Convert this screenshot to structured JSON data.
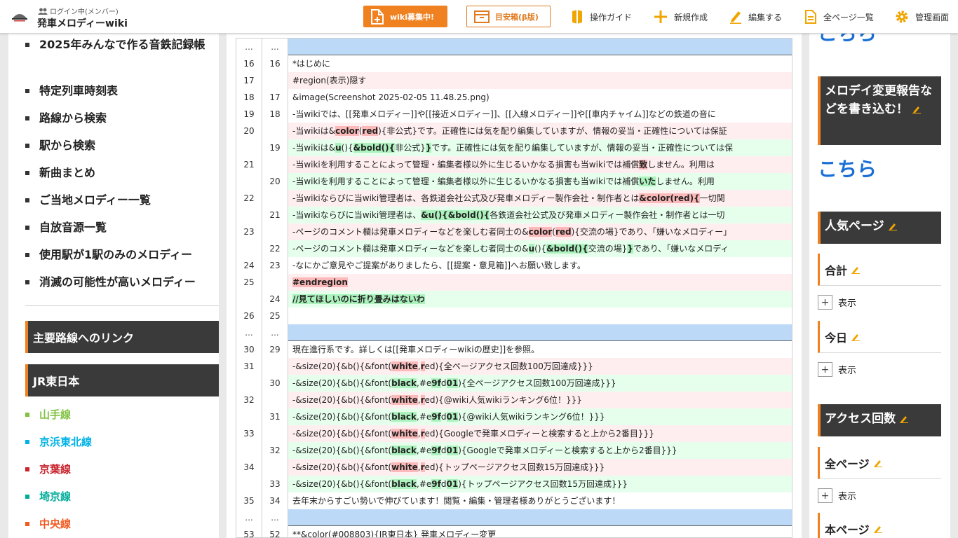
{
  "header": {
    "login_status": "ログイン中(メンバー)",
    "site_title": "発車メロディーwiki",
    "recruit_button": "wiki募集中!",
    "box_button": "目安箱(β版)",
    "nav": [
      "操作ガイド",
      "新規作成",
      "編集する",
      "全ページ一覧",
      "管理画面"
    ]
  },
  "left_menu": {
    "items": [
      "2025年みんなで作る音鉄記録帳",
      "特定列車時刻表",
      "路線から検索",
      "駅から検索",
      "新曲まとめ",
      "ご当地メロディー一覧",
      "自放音源一覧",
      "使用駅が1駅のみのメロディー",
      "消滅の可能性が高いメロディー"
    ],
    "section_main_links": "主要路線へのリンク",
    "section_jr_east": "JR東日本",
    "lines": [
      {
        "label": "山手線",
        "color": "#80c241"
      },
      {
        "label": "京浜東北線",
        "color": "#00b2e5"
      },
      {
        "label": "京葉線",
        "color": "#c9252f"
      },
      {
        "label": "埼京線",
        "color": "#00ac9a"
      },
      {
        "label": "中央線",
        "color": "#f15a22"
      }
    ]
  },
  "diff": {
    "rows": [
      {
        "type": "hunk",
        "l": "...",
        "r": "...",
        "segs": []
      },
      {
        "type": "ctx",
        "l": "16",
        "r": "16",
        "segs": [
          {
            "t": "*はじめに"
          }
        ]
      },
      {
        "type": "del",
        "l": "17",
        "r": "",
        "segs": [
          {
            "t": "#region(表示)隠す"
          }
        ]
      },
      {
        "type": "ctx",
        "l": "18",
        "r": "17",
        "segs": [
          {
            "t": "&image(Screenshot 2025-02-05 11.48.25.png)"
          }
        ]
      },
      {
        "type": "ctx",
        "l": "19",
        "r": "18",
        "segs": [
          {
            "t": "-当wikiでは、[[発車メロディー]]や[[接近メロディー]]、[[入線メロディー]]や[[車内チャイム]]などの鉄道の音に"
          }
        ]
      },
      {
        "type": "del",
        "l": "20",
        "r": "",
        "segs": [
          {
            "t": "-当wikiは&"
          },
          {
            "t": "color",
            "h": 1
          },
          {
            "t": "("
          },
          {
            "t": "red",
            "h": 1
          },
          {
            "t": "){非公式}です。正確性には気を配り編集していますが、情報の妥当・正確性については保証"
          }
        ]
      },
      {
        "type": "ins",
        "l": "",
        "r": "19",
        "segs": [
          {
            "t": "-当wikiは&"
          },
          {
            "t": "u",
            "h": 1
          },
          {
            "t": "(){"
          },
          {
            "t": "&bold(){",
            "h": 1
          },
          {
            "t": "非公式}"
          },
          {
            "t": "}",
            "h": 1
          },
          {
            "t": "です。正確性には気を配り編集していますが、情報の妥当・正確性については保"
          }
        ]
      },
      {
        "type": "del",
        "l": "21",
        "r": "",
        "segs": [
          {
            "t": "-当wikiを利用することによって管理・編集者様以外に生じるいかなる損害も当wikiでは補償"
          },
          {
            "t": "致",
            "h": 1
          },
          {
            "t": "しません。利用は"
          }
        ]
      },
      {
        "type": "ins",
        "l": "",
        "r": "20",
        "segs": [
          {
            "t": "-当wikiを利用することによって管理・編集者様以外に生じるいかなる損害も当wikiでは補償"
          },
          {
            "t": "いた",
            "h": 1
          },
          {
            "t": "しません。利用"
          }
        ]
      },
      {
        "type": "del",
        "l": "22",
        "r": "",
        "segs": [
          {
            "t": "-当wikiならびに当wiki管理者は、各鉄道会社公式及び発車メロディー製作会社・制作者とは"
          },
          {
            "t": "&color(red){",
            "h": 1
          },
          {
            "t": "一切関"
          }
        ]
      },
      {
        "type": "ins",
        "l": "",
        "r": "21",
        "segs": [
          {
            "t": "-当wikiならびに当wiki管理者は、"
          },
          {
            "t": "&u(){&bold(){",
            "h": 1
          },
          {
            "t": "各鉄道会社公式及び発車メロディー製作会社・制作者とは一切"
          }
        ]
      },
      {
        "type": "del",
        "l": "23",
        "r": "",
        "segs": [
          {
            "t": "-ページのコメント欄は発車メロディーなどを楽しむ者同士の&"
          },
          {
            "t": "color",
            "h": 1
          },
          {
            "t": "("
          },
          {
            "t": "red",
            "h": 1
          },
          {
            "t": "){交流の場}であり、「嫌いなメロディー」"
          }
        ]
      },
      {
        "type": "ins",
        "l": "",
        "r": "22",
        "segs": [
          {
            "t": "-ページのコメント欄は発車メロディーなどを楽しむ者同士の&"
          },
          {
            "t": "u",
            "h": 1
          },
          {
            "t": "(){"
          },
          {
            "t": "&bold(){",
            "h": 1
          },
          {
            "t": "交流の場}"
          },
          {
            "t": "}",
            "h": 1
          },
          {
            "t": "であり、「嫌いなメロディ"
          }
        ]
      },
      {
        "type": "ctx",
        "l": "24",
        "r": "23",
        "segs": [
          {
            "t": "-なにかご意見やご提案がありましたら、[[提案・意見箱]]へお願い致します。"
          }
        ]
      },
      {
        "type": "del",
        "l": "25",
        "r": "",
        "segs": [
          {
            "t": "#endregion",
            "h": 1
          }
        ]
      },
      {
        "type": "ins",
        "l": "",
        "r": "24",
        "segs": [
          {
            "t": "//見てほしいのに折り畳みはないわ",
            "h": 1
          }
        ]
      },
      {
        "type": "ctx",
        "l": "26",
        "r": "25",
        "segs": []
      },
      {
        "type": "hunk",
        "l": "...",
        "r": "...",
        "segs": []
      },
      {
        "type": "ctx",
        "l": "30",
        "r": "29",
        "segs": [
          {
            "t": "現在進行系です。詳しくは[[発車メロディーwikiの歴史]]を参照。"
          }
        ]
      },
      {
        "type": "del",
        "l": "31",
        "r": "",
        "segs": [
          {
            "t": "-&size(20){&b(){&font("
          },
          {
            "t": "white",
            "h": 1
          },
          {
            "t": ","
          },
          {
            "t": "r",
            "h": 1
          },
          {
            "t": "ed){全ページアクセス回数100万回達成}}}"
          }
        ]
      },
      {
        "type": "ins",
        "l": "",
        "r": "30",
        "segs": [
          {
            "t": "-&size(20){&b(){&font("
          },
          {
            "t": "black",
            "h": 1
          },
          {
            "t": ",#e"
          },
          {
            "t": "9f",
            "h": 1
          },
          {
            "t": "d"
          },
          {
            "t": "01",
            "h": 1
          },
          {
            "t": "){全ページアクセス回数100万回達成}}}"
          }
        ]
      },
      {
        "type": "del",
        "l": "32",
        "r": "",
        "segs": [
          {
            "t": "-&size(20){&b(){&font("
          },
          {
            "t": "white",
            "h": 1
          },
          {
            "t": ","
          },
          {
            "t": "r",
            "h": 1
          },
          {
            "t": "ed){@wiki人気wikiランキング6位！}}}"
          }
        ]
      },
      {
        "type": "ins",
        "l": "",
        "r": "31",
        "segs": [
          {
            "t": "-&size(20){&b(){&font("
          },
          {
            "t": "black",
            "h": 1
          },
          {
            "t": ",#e"
          },
          {
            "t": "9f",
            "h": 1
          },
          {
            "t": "d"
          },
          {
            "t": "01",
            "h": 1
          },
          {
            "t": "){@wiki人気wikiランキング6位！}}}"
          }
        ]
      },
      {
        "type": "del",
        "l": "33",
        "r": "",
        "segs": [
          {
            "t": "-&size(20){&b(){&font("
          },
          {
            "t": "white",
            "h": 1
          },
          {
            "t": ","
          },
          {
            "t": "r",
            "h": 1
          },
          {
            "t": "ed){Googleで発車メロディーと検索すると上から2番目}}}"
          }
        ]
      },
      {
        "type": "ins",
        "l": "",
        "r": "32",
        "segs": [
          {
            "t": "-&size(20){&b(){&font("
          },
          {
            "t": "black",
            "h": 1
          },
          {
            "t": ",#e"
          },
          {
            "t": "9f",
            "h": 1
          },
          {
            "t": "d"
          },
          {
            "t": "01",
            "h": 1
          },
          {
            "t": "){Googleで発車メロディーと検索すると上から2番目}}}"
          }
        ]
      },
      {
        "type": "del",
        "l": "34",
        "r": "",
        "segs": [
          {
            "t": "-&size(20){&b(){&font("
          },
          {
            "t": "white",
            "h": 1
          },
          {
            "t": ","
          },
          {
            "t": "r",
            "h": 1
          },
          {
            "t": "ed){トップページアクセス回数15万回達成}}}"
          }
        ]
      },
      {
        "type": "ins",
        "l": "",
        "r": "33",
        "segs": [
          {
            "t": "-&size(20){&b(){&font("
          },
          {
            "t": "black",
            "h": 1
          },
          {
            "t": ",#e"
          },
          {
            "t": "9f",
            "h": 1
          },
          {
            "t": "d"
          },
          {
            "t": "01",
            "h": 1
          },
          {
            "t": "){トップページアクセス回数15万回達成}}}"
          }
        ]
      },
      {
        "type": "ctx",
        "l": "35",
        "r": "34",
        "segs": [
          {
            "t": "去年末からすごい勢いで伸びています！閲覧・編集・管理者様ありがとうございます！"
          }
        ]
      },
      {
        "type": "hunk",
        "l": "...",
        "r": "...",
        "segs": []
      },
      {
        "type": "ctx",
        "l": "53",
        "r": "52",
        "segs": [
          {
            "t": "**&color(#008803){JR東日本} 発車メロディー変更"
          }
        ]
      }
    ]
  },
  "right": {
    "top_link": "こちら",
    "report_head": "メロデイ変更報告などを書き込む！",
    "report_link": "こちら",
    "popular_head": "人気ページ",
    "total": "合計",
    "today": "今日",
    "show": "表示",
    "plus": "+",
    "access_head": "アクセス回数",
    "all_pages": "全ページ",
    "this_page": "本ページ"
  }
}
